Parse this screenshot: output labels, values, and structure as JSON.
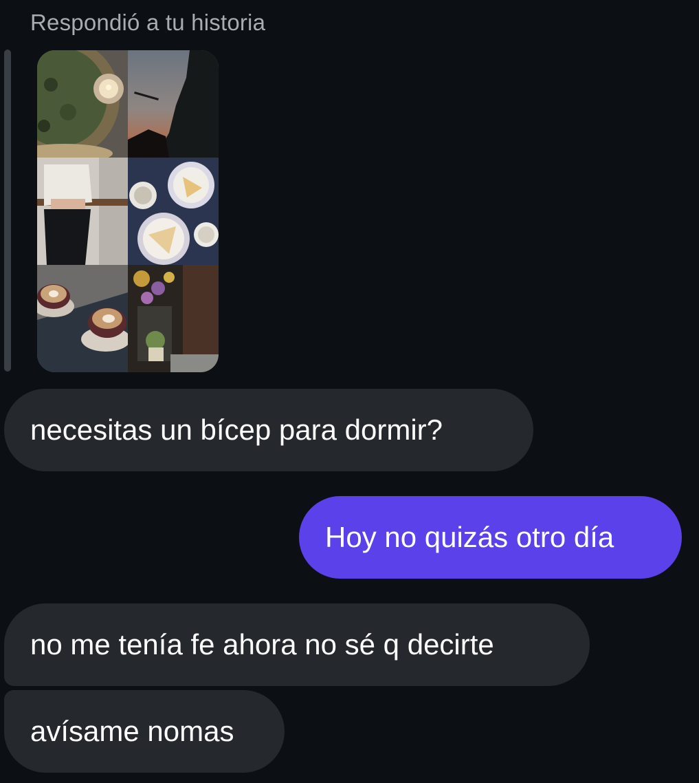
{
  "reply_context": {
    "label": "Respondió a tu historia"
  },
  "story": {
    "tiles": [
      {
        "icon": "pizza-candle-photo-icon"
      },
      {
        "icon": "sunset-trees-photo-icon"
      },
      {
        "icon": "person-mirror-photo-icon"
      },
      {
        "icon": "tea-cake-table-photo-icon"
      },
      {
        "icon": "latte-cups-photo-icon"
      },
      {
        "icon": "flowers-shop-photo-icon"
      }
    ]
  },
  "messages": [
    {
      "direction": "incoming",
      "text": "necesitas un bícep para dormir?"
    },
    {
      "direction": "outgoing",
      "text": "Hoy no quizás otro día"
    },
    {
      "direction": "incoming",
      "text": "no me tenía fe ahora no sé q decirte"
    },
    {
      "direction": "incoming",
      "text": "avísame nomas"
    }
  ],
  "colors": {
    "background": "#0c1014",
    "incoming_bubble": "#25292e",
    "outgoing_bubble": "#5a41ea",
    "label_text": "#a8adb3"
  }
}
